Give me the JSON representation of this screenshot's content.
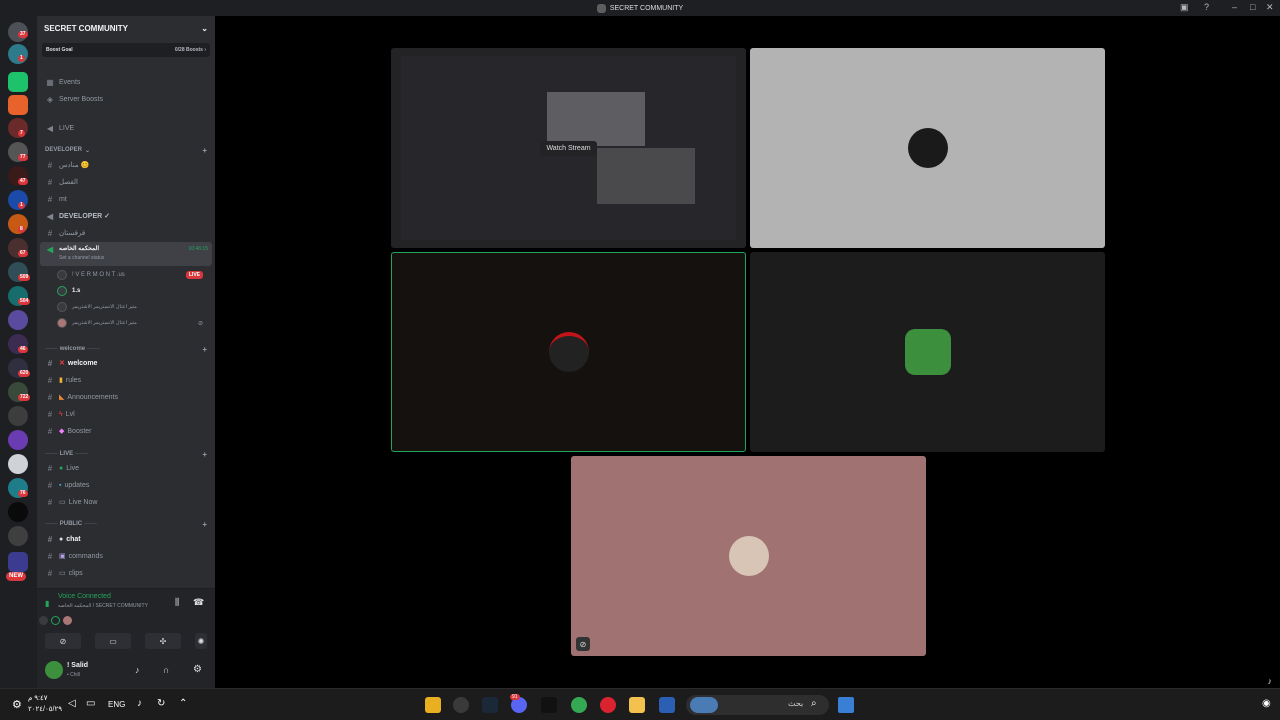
{
  "window": {
    "title": "SECRET COMMUNITY"
  },
  "guild_badges": [
    "37",
    "1",
    "",
    "",
    "7",
    "77",
    "47",
    "1",
    "8",
    "67",
    "509",
    "504",
    "",
    "46",
    "620",
    "722",
    "",
    "76",
    "",
    "",
    "NEW"
  ],
  "server": {
    "name": "SECRET COMMUNITY",
    "boost_goal_label": "Boost Goal",
    "boost_count": "0/28 Boosts ›",
    "events_label": "Events",
    "server_boosts_label": "Server Boosts"
  },
  "channels": {
    "live_label": "LIVE",
    "developer_category": "DEVELOPER",
    "dev_items": [
      "منادس 😊",
      "الفصل",
      "mt",
      "DEVELOPER ✓",
      "قرقستان"
    ],
    "active_voice": {
      "name": "المحكمه الخاصه",
      "status": "Set a channel status",
      "timer": "10:46:15"
    },
    "voice_users": [
      {
        "name": "! V E R M O N T .us",
        "live": "LIVE"
      },
      {
        "name": "1.s"
      },
      {
        "name": "متير اعتال الانستريمر الاشتريمر"
      },
      {
        "name": "متير اعتال الانستريمر الاشتريمر"
      }
    ],
    "welcome_category": "welcome",
    "welcome_items": [
      "welcome",
      "rules",
      "Announcements",
      "Lvl",
      "Booster"
    ],
    "live_category": "LIVE",
    "live_items": [
      "Live",
      "updates",
      "Live Now"
    ],
    "public_category": "PUBLIC",
    "public_items": [
      "chat",
      "commands",
      "clips"
    ]
  },
  "voice": {
    "connected_label": "Voice Connected",
    "location": "المحكمه الخاصه / SECRET COMMUNITY"
  },
  "user": {
    "name": "! Salid",
    "status": "• Chill"
  },
  "stage": {
    "watch_stream_label": "Watch Stream"
  },
  "taskbar": {
    "lang": "ENG",
    "search_placeholder": "بحث",
    "time": "٩:٤٧ م",
    "date": "٢٠٢٤/٠٥/٢٩",
    "discord_badge": "91"
  }
}
